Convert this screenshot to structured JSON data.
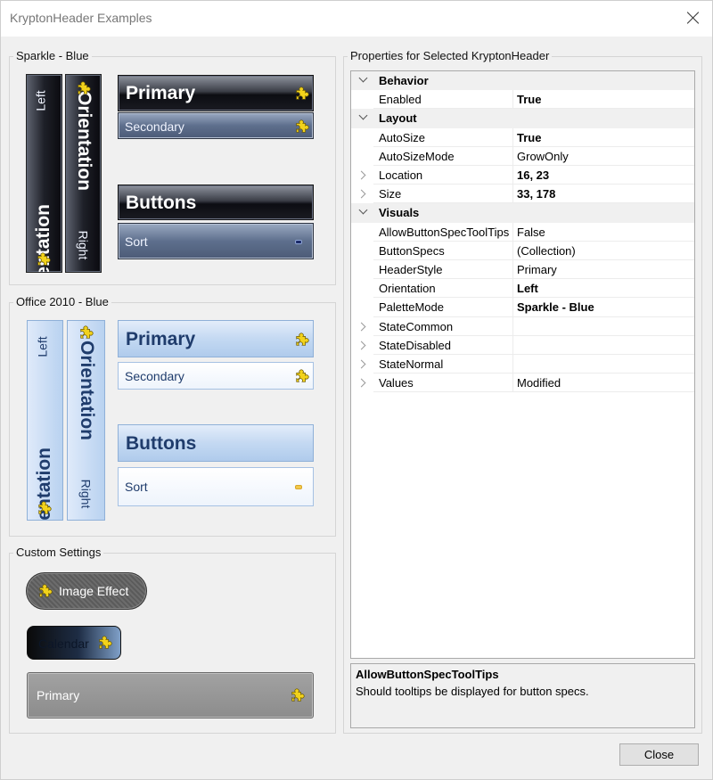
{
  "window": {
    "title": "KryptonHeader Examples"
  },
  "groups": {
    "sparkle": "Sparkle - Blue",
    "office": "Office 2010 - Blue",
    "custom": "Custom Settings",
    "properties": "Properties for Selected KryptonHeader"
  },
  "sparkle": {
    "vleft_primary": "Orientation",
    "vleft_secondary": "Left",
    "vright_primary": "Orientation",
    "vright_secondary": "Right",
    "primary": "Primary",
    "secondary": "Secondary",
    "buttons": "Buttons",
    "sort": "Sort"
  },
  "office": {
    "vleft_primary": "Orientation",
    "vleft_secondary": "Left",
    "vright_primary": "Orientation",
    "vright_secondary": "Right",
    "primary": "Primary",
    "secondary": "Secondary",
    "buttons": "Buttons",
    "sort": "Sort"
  },
  "custom": {
    "image_effect": "Image Effect",
    "calendar": "Calendar",
    "primary": "Primary"
  },
  "property_grid": {
    "rows": [
      {
        "kind": "category",
        "name": "Behavior"
      },
      {
        "kind": "property",
        "name": "Enabled",
        "value": "True",
        "bold": true
      },
      {
        "kind": "category",
        "name": "Layout"
      },
      {
        "kind": "property",
        "name": "AutoSize",
        "value": "True",
        "bold": true
      },
      {
        "kind": "property",
        "name": "AutoSizeMode",
        "value": "GrowOnly",
        "bold": false
      },
      {
        "kind": "property",
        "name": "Location",
        "value": "16, 23",
        "bold": true,
        "expandable": true
      },
      {
        "kind": "property",
        "name": "Size",
        "value": "33, 178",
        "bold": true,
        "expandable": true
      },
      {
        "kind": "category",
        "name": "Visuals"
      },
      {
        "kind": "property",
        "name": "AllowButtonSpecToolTips",
        "value": "False",
        "bold": false
      },
      {
        "kind": "property",
        "name": "ButtonSpecs",
        "value": "(Collection)",
        "bold": false
      },
      {
        "kind": "property",
        "name": "HeaderStyle",
        "value": "Primary",
        "bold": false
      },
      {
        "kind": "property",
        "name": "Orientation",
        "value": "Left",
        "bold": true
      },
      {
        "kind": "property",
        "name": "PaletteMode",
        "value": "Sparkle - Blue",
        "bold": true
      },
      {
        "kind": "property",
        "name": "StateCommon",
        "value": "",
        "bold": false,
        "expandable": true
      },
      {
        "kind": "property",
        "name": "StateDisabled",
        "value": "",
        "bold": false,
        "expandable": true
      },
      {
        "kind": "property",
        "name": "StateNormal",
        "value": "",
        "bold": false,
        "expandable": true
      },
      {
        "kind": "property",
        "name": "Values",
        "value": "Modified",
        "bold": false,
        "expandable": true
      }
    ]
  },
  "description": {
    "title": "AllowButtonSpecToolTips",
    "text": "Should tooltips be displayed for button specs."
  },
  "buttons": {
    "close": "Close"
  },
  "colors": {
    "sparkle_dark": "#0c0d12",
    "office_blue": "#b9d2f0",
    "office_text": "#1f3c6c",
    "puzzle_yellow": "#f2d21b"
  },
  "icons": {
    "puzzle": "puzzle-icon",
    "close": "close-icon",
    "expand": "chevron-right-icon",
    "collapse": "chevron-down-icon"
  }
}
